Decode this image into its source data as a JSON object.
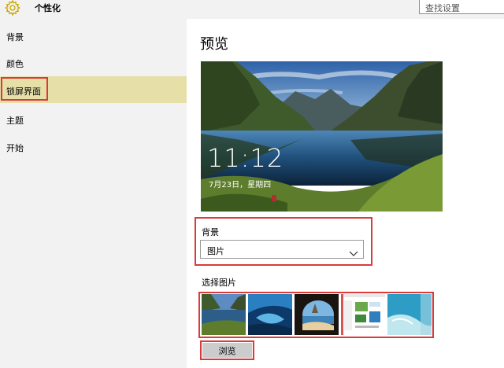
{
  "header": {
    "title": "个性化",
    "search_placeholder": "查找设置",
    "icon": "gear-icon"
  },
  "sidebar": {
    "items": [
      {
        "label": "背景",
        "active": false
      },
      {
        "label": "颜色",
        "active": false
      },
      {
        "label": "锁屏界面",
        "active": true
      },
      {
        "label": "主题",
        "active": false
      },
      {
        "label": "开始",
        "active": false
      }
    ]
  },
  "main": {
    "preview_title": "预览",
    "lock_time": "11:12",
    "lock_date": "7月23日，星期四",
    "background_label": "背景",
    "background_value": "图片",
    "choose_picture_label": "选择图片",
    "browse_label": "浏览"
  },
  "colors": {
    "highlight": "#d93a3a",
    "active_bg": "#e6e0a8",
    "sidebar_bg": "#f2f2f2"
  }
}
